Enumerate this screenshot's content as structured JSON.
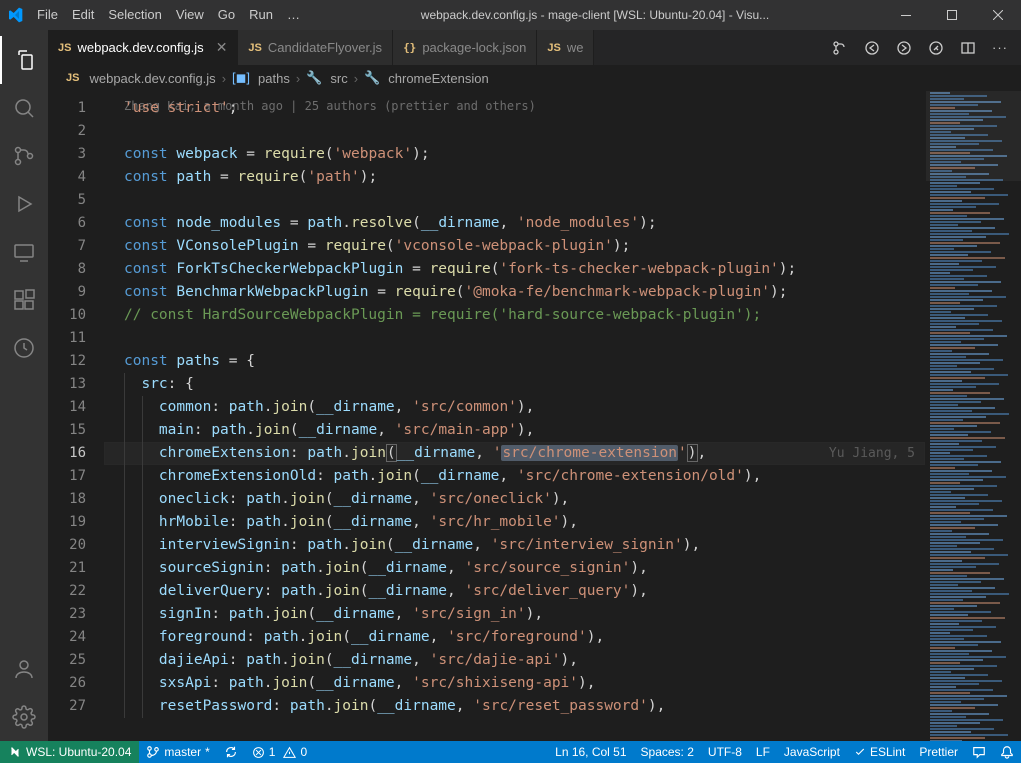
{
  "window": {
    "title": "webpack.dev.config.js - mage-client [WSL: Ubuntu-20.04] - Visu..."
  },
  "menu": [
    "File",
    "Edit",
    "Selection",
    "View",
    "Go",
    "Run",
    "…"
  ],
  "activitybar": {
    "items": [
      "explorer",
      "search",
      "scm",
      "debug",
      "remote",
      "extensions",
      "timeline"
    ]
  },
  "tabs": [
    {
      "label": "webpack.dev.config.js",
      "icon": "JS",
      "active": true,
      "closable": true
    },
    {
      "label": "CandidateFlyover.js",
      "icon": "JS",
      "active": false,
      "closable": false
    },
    {
      "label": "package-lock.json",
      "icon": "{}",
      "active": false,
      "closable": false
    },
    {
      "label": "we",
      "icon": "JS",
      "active": false,
      "closable": false
    }
  ],
  "breadcrumb": {
    "file": "webpack.dev.config.js",
    "symbol1": "paths",
    "symbol2": "src",
    "symbol3": "chromeExtension"
  },
  "blame": "Zhang Kai, a month ago | 25 authors (prettier and others)",
  "code": {
    "line1": "'use strict'",
    "l3_kw": "const",
    "l3_var": "webpack",
    "l3_fn": "require",
    "l3_str": "'webpack'",
    "l4_var": "path",
    "l4_str": "'path'",
    "l6_var": "node_modules",
    "l6_obj": "path",
    "l6_fn": "resolve",
    "l6_arg1": "__dirname",
    "l6_str": "'node_modules'",
    "l7_var": "VConsolePlugin",
    "l7_str": "'vconsole-webpack-plugin'",
    "l8_var": "ForkTsCheckerWebpackPlugin",
    "l8_str": "'fork-ts-checker-webpack-plugin'",
    "l9_var": "BenchmarkWebpackPlugin",
    "l9_str": "'@moka-fe/benchmark-webpack-plugin'",
    "l10": "// const HardSourceWebpackPlugin = require('hard-source-webpack-plugin');",
    "l12_var": "paths",
    "l13_key": "src",
    "entries": [
      {
        "key": "common",
        "path": "'src/common'"
      },
      {
        "key": "main",
        "path": "'src/main-app'"
      },
      {
        "key": "chromeExtension",
        "path": "'src/chrome-extension'",
        "lens": "Yu Jiang, 5"
      },
      {
        "key": "chromeExtensionOld",
        "path": "'src/chrome-extension/old'"
      },
      {
        "key": "oneclick",
        "path": "'src/oneclick'"
      },
      {
        "key": "hrMobile",
        "path": "'src/hr_mobile'"
      },
      {
        "key": "interviewSignin",
        "path": "'src/interview_signin'"
      },
      {
        "key": "sourceSignin",
        "path": "'src/source_signin'"
      },
      {
        "key": "deliverQuery",
        "path": "'src/deliver_query'"
      },
      {
        "key": "signIn",
        "path": "'src/sign_in'"
      },
      {
        "key": "foreground",
        "path": "'src/foreground'"
      },
      {
        "key": "dajieApi",
        "path": "'src/dajie-api'"
      },
      {
        "key": "sxsApi",
        "path": "'src/shixiseng-api'"
      },
      {
        "key": "resetPassword",
        "path": "'src/reset_password'"
      }
    ]
  },
  "statusbar": {
    "remote": "WSL: Ubuntu-20.04",
    "branch": "master",
    "errors": "1",
    "warnings": "0",
    "cursor": "Ln 16, Col 51",
    "spaces": "Spaces: 2",
    "encoding": "UTF-8",
    "eol": "LF",
    "lang": "JavaScript",
    "eslint": "ESLint",
    "prettier": "Prettier"
  }
}
